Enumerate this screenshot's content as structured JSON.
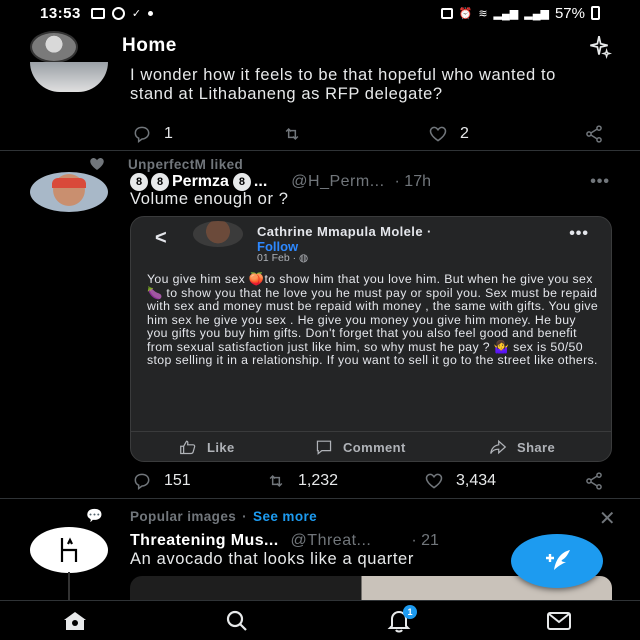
{
  "status_bar": {
    "time": "13:53",
    "battery": "57%",
    "left_icons": [
      "gallery-icon",
      "whatsapp-icon",
      "download-done-icon",
      "dot-icon"
    ],
    "right_icons": [
      "nfc-icon",
      "alarm-icon",
      "wifi-call-icon",
      "signal-icon",
      "signal-icon",
      "battery-icon"
    ]
  },
  "header": {
    "title": "Home"
  },
  "tweets": [
    {
      "text": "I wonder how it feels to be that hopeful who wanted to stand at Lithabaneng as RFP delegate?",
      "replies": "1",
      "retweets": "",
      "likes": "2"
    },
    {
      "social_context": "UnperfectM liked",
      "name": "Permza",
      "name_badge": "8",
      "name_suffix": "...",
      "handle": "@H_Perm...",
      "time": "· 17h",
      "text": "Volume enough or ?",
      "replies": "151",
      "retweets": "1,232",
      "likes": "3,434",
      "embedded_card": {
        "author": "Cathrine Mmapula Molele ·",
        "follow": "Follow",
        "date": "01 Feb ·",
        "body": "You give him sex 🍑to show him that you love him. But when he give you sex 🍆 to show you that he love you he must pay or spoil you. Sex must be repaid with sex and money must be repaid with money , the same with gifts. You give him sex he give you sex . He give you money you give him money. He buy you gifts you buy him gifts. Don't forget that you also feel good and benefit from sexual satisfaction just like him, so why must he pay ? 🤷‍♀️ sex is 50/50 stop selling it in a relationship. If you want to sell it go to the street like others.",
        "like_label": "Like",
        "comment_label": "Comment",
        "share_label": "Share"
      }
    },
    {
      "social_context": "Popular images",
      "see_more": "See more",
      "name": "Threatening Mus...",
      "handle": "@Threat...",
      "time": "· 21",
      "text": "An avocado that looks like a quarter"
    }
  ],
  "notification_count": "1",
  "colors": {
    "accent": "#1d9bf0",
    "background": "#000000",
    "muted": "#71767b",
    "card_bg": "#242526",
    "fb_blue": "#2d88ff"
  }
}
